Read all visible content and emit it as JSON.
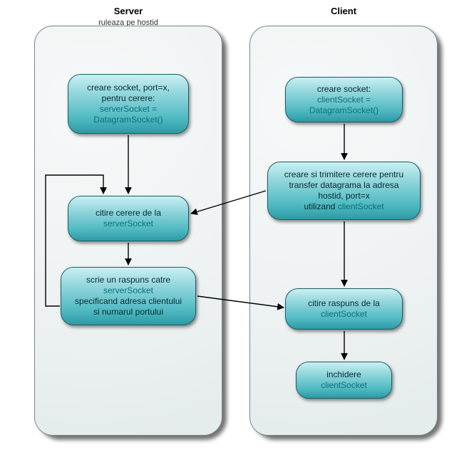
{
  "diagram": {
    "server": {
      "title": "Server",
      "subtitle": "ruleaza pe hostid",
      "nodes": {
        "create": {
          "l1": "creare socket, port=x,",
          "l2": "pentru cerere:",
          "l3": "serverSocket =",
          "l4": "DatagramSocket()"
        },
        "read": {
          "l1": "citire cerere de la",
          "l2": "serverSocket"
        },
        "write": {
          "l1": "scrie un raspuns catre",
          "l2": "serverSocket",
          "l3": "specificand adresa clientului",
          "l4": "si numarul portului"
        }
      }
    },
    "client": {
      "title": "Client",
      "nodes": {
        "create": {
          "l1": "creare socket:",
          "l2": "clientSocket =",
          "l3": "DatagramSocket()"
        },
        "send": {
          "l1": "creare si trimitere cerere pentru",
          "l2": "transfer datagrama la adresa",
          "l3": "hostid, port=x",
          "l4a": "utilizand ",
          "l4b": "clientSocket"
        },
        "read": {
          "l1": "citire raspuns de la",
          "l2": "clientSocket"
        },
        "close": {
          "l1": "inchidere",
          "l2": "clientSocket"
        }
      }
    }
  }
}
